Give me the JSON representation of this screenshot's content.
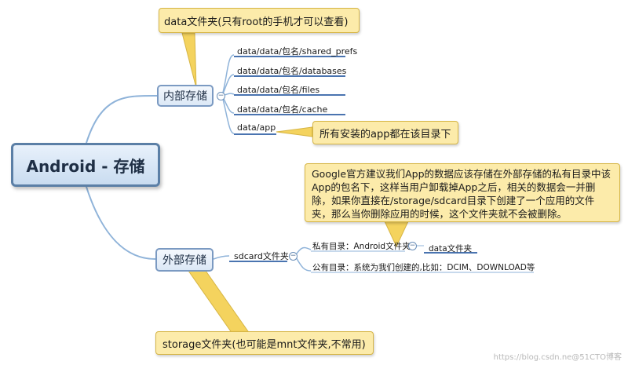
{
  "root": {
    "label": "Android - 存储"
  },
  "internal": {
    "label": "内部存储",
    "items": [
      "data/data/包名/shared_prefs",
      "data/data/包名/databases",
      "data/data/包名/files",
      "data/data/包名/cache",
      "data/app"
    ],
    "note_root": "data文件夹(只有root的手机才可以查看)",
    "note_app": "所有安装的app都在该目录下"
  },
  "external": {
    "label": "外部存储",
    "sdcard": "sdcard文件夹",
    "private_dir": "私有目录：Android文件夹",
    "private_child": "data文件夹",
    "public_dir": "公有目录：系统为我们创建的,比如：DCIM、DOWNLOAD等",
    "note_google": "Google官方建议我们App的数据应该存储在外部存储的私有目录中该App的包名下，这样当用户卸载掉App之后，相关的数据会一并删除，如果你直接在/storage/sdcard目录下创建了一个应用的文件夹，那么当你删除应用的时候，这个文件夹就不会被删除。",
    "note_storage": "storage文件夹(也可能是mnt文件夹,不常用)"
  },
  "watermark": "https://blog.csdn.ne@51CTO博客",
  "colors": {
    "branch": "#8fb3d9",
    "underline": "#4a74b0",
    "note_bg": "#fcebaa",
    "note_border": "#d6b545"
  }
}
